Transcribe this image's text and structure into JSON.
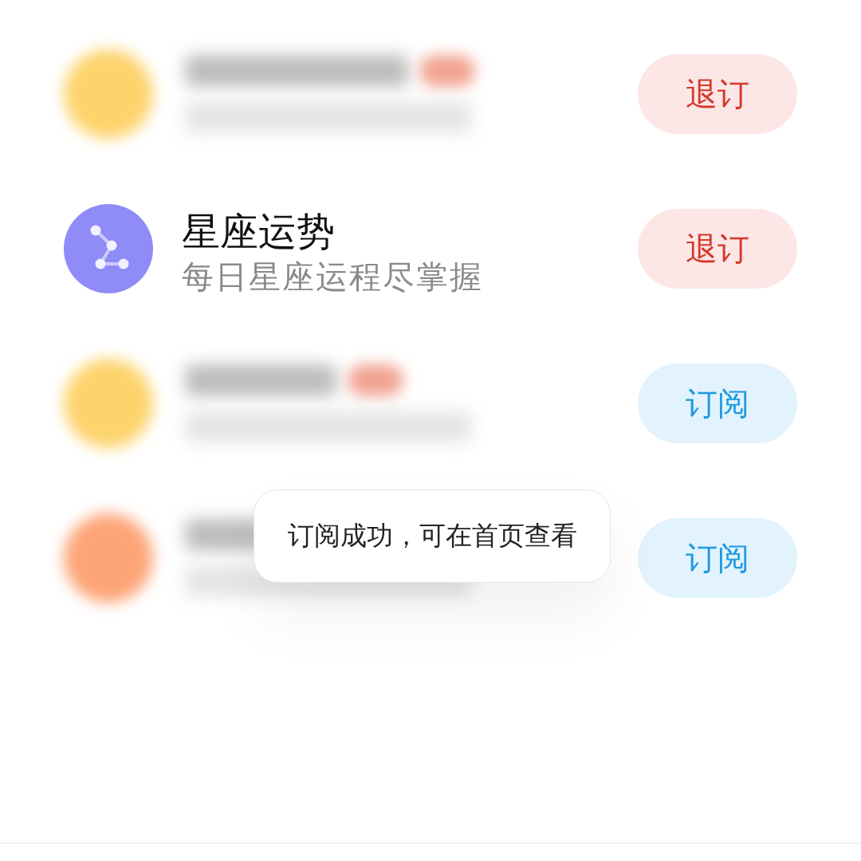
{
  "items": [
    {
      "kind": "badged",
      "color": "#fdd36c",
      "button": {
        "label": "退订",
        "subscribed": true
      }
    },
    {
      "kind": "plain",
      "color": "#8f8cf8",
      "title": "星座运势",
      "subtitle": "每日星座运程尽掌握",
      "button": {
        "label": "退订",
        "subscribed": true
      }
    },
    {
      "kind": "badged",
      "color": "#fdd36c",
      "button": {
        "label": "订阅",
        "subscribed": false
      }
    },
    {
      "kind": "blurred",
      "color": "#fda577",
      "button": {
        "label": "订阅",
        "subscribed": false
      }
    }
  ],
  "toast": {
    "text": "订阅成功，可在首页查看"
  }
}
